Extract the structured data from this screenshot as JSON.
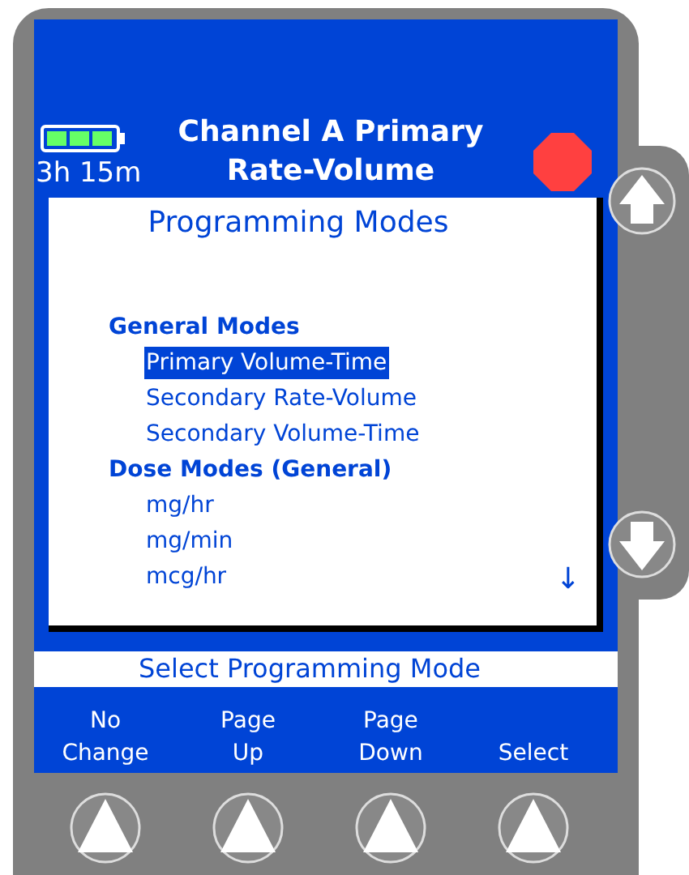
{
  "header": {
    "time_remaining": "3h 15m",
    "title": "Channel A Primary",
    "subtitle": "Rate-Volume"
  },
  "list": {
    "title": "Programming Modes",
    "items": [
      {
        "kind": "heading",
        "label": "General Modes",
        "selected": false
      },
      {
        "kind": "option",
        "label": "Primary Volume-Time",
        "selected": true
      },
      {
        "kind": "option",
        "label": "Secondary Rate-Volume",
        "selected": false
      },
      {
        "kind": "option",
        "label": "Secondary Volume-Time",
        "selected": false
      },
      {
        "kind": "heading",
        "label": "Dose Modes (General)",
        "selected": false
      },
      {
        "kind": "option",
        "label": "mg/hr",
        "selected": false
      },
      {
        "kind": "option",
        "label": "mg/min",
        "selected": false
      },
      {
        "kind": "option",
        "label": "mcg/hr",
        "selected": false
      }
    ],
    "more_indicator": "↓"
  },
  "prompt": "Select Programming Mode",
  "softkeys": [
    {
      "label": "No\nChange"
    },
    {
      "label": "Page\nUp"
    },
    {
      "label": "Page\nDown"
    },
    {
      "label": "Select"
    }
  ]
}
